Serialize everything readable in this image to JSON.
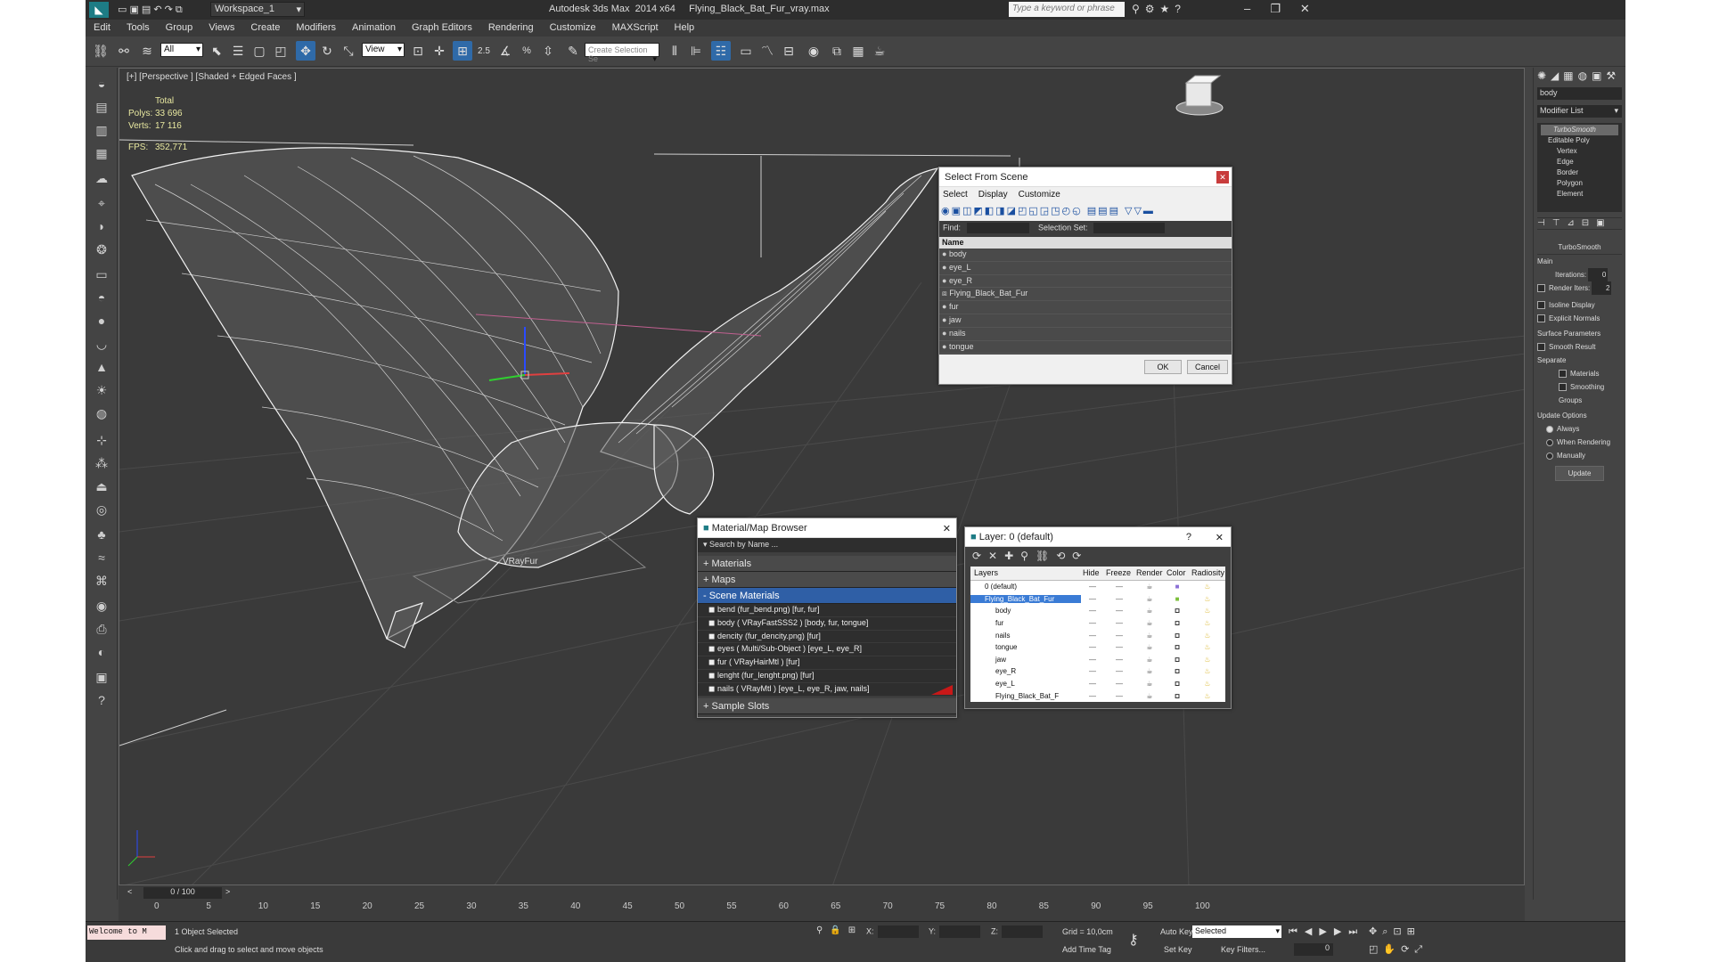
{
  "titlebar": {
    "workspace": "Workspace_1",
    "title": "Autodesk 3ds Max  2014 x64     Flying_Black_Bat_Fur_vray.max",
    "search_placeholder": "Type a keyword or phrase"
  },
  "menu": [
    "Edit",
    "Tools",
    "Group",
    "Views",
    "Create",
    "Modifiers",
    "Animation",
    "Graph Editors",
    "Rendering",
    "Customize",
    "MAXScript",
    "Help"
  ],
  "toolbar": {
    "filter": "All",
    "view": "View",
    "selection_set": "Create Selection Se",
    "angle": "2.5"
  },
  "viewport": {
    "label": "[+] [Perspective ] [Shaded + Edged Faces ]",
    "stats_total": "Total",
    "polys_label": "Polys:",
    "polys": "33 696",
    "verts_label": "Verts:",
    "verts": "17 116",
    "fps_label": "FPS:",
    "fps": "352,771",
    "vrayfur_label": "VRayFur"
  },
  "right_panel": {
    "object_name": "body",
    "modifier_list": "Modifier List",
    "stack": [
      "TurboSmooth",
      "Editable Poly",
      "Vertex",
      "Edge",
      "Border",
      "Polygon",
      "Element"
    ],
    "rollout": "TurboSmooth",
    "main": "Main",
    "iterations_label": "Iterations:",
    "iterations": "0",
    "render_iters_label": "Render Iters:",
    "render_iters": "2",
    "isoline": "Isoline Display",
    "explicit": "Explicit Normals",
    "surface_params": "Surface Parameters",
    "smooth_result": "Smooth Result",
    "separate": "Separate",
    "materials": "Materials",
    "smoothing_groups": "Smoothing Groups",
    "update_options": "Update Options",
    "always": "Always",
    "when_rendering": "When Rendering",
    "manually": "Manually",
    "update_btn": "Update"
  },
  "select_dialog": {
    "title": "Select From Scene",
    "menu": [
      "Select",
      "Display",
      "Customize"
    ],
    "find_label": "Find:",
    "selection_set_label": "Selection Set:",
    "col_name": "Name",
    "items": [
      "body",
      "eye_L",
      "eye_R",
      "Flying_Black_Bat_Fur",
      "fur",
      "jaw",
      "nails",
      "tongue"
    ],
    "ok": "OK",
    "cancel": "Cancel"
  },
  "material_browser": {
    "title": "Material/Map Browser",
    "search": "Search by Name ...",
    "materials": "+ Materials",
    "maps": "+ Maps",
    "scene_materials": "- Scene Materials",
    "items": [
      "bend (fur_bend.png)  [fur, fur]",
      "body  ( VRayFastSSS2 )  [body, fur, tongue]",
      "dencity (fur_dencity.png)  [fur]",
      "eyes  ( Multi/Sub-Object )  [eye_L, eye_R]",
      "fur  ( VRayHairMtl )  [fur]",
      "lenght (fur_lenght.png)  [fur]",
      "nails  ( VRayMtl )  [eye_L, eye_R, jaw, nails]"
    ],
    "sample_slots": "+ Sample Slots"
  },
  "layer_dialog": {
    "title": "Layer: 0 (default)",
    "help": "?",
    "cols": [
      "Layers",
      "Hide",
      "Freeze",
      "Render",
      "Color",
      "Radiosity"
    ],
    "rows": [
      "0 (default)",
      "Flying_Black_Bat_Fur",
      "body",
      "fur",
      "nails",
      "tongue",
      "jaw",
      "eye_R",
      "eye_L",
      "Flying_Black_Bat_F"
    ]
  },
  "timeline": {
    "frame": "0 / 100",
    "ticks": [
      "0",
      "5",
      "10",
      "15",
      "20",
      "25",
      "30",
      "35",
      "40",
      "45",
      "50",
      "55",
      "60",
      "65",
      "70",
      "75",
      "80",
      "85",
      "90",
      "95",
      "100"
    ]
  },
  "status": {
    "welcome": "Welcome to M",
    "selected": "1 Object Selected",
    "hint": "Click and drag to select and move objects",
    "x_label": "X:",
    "y_label": "Y:",
    "z_label": "Z:",
    "grid": "Grid = 10,0cm",
    "add_time_tag": "Add Time Tag",
    "auto_key": "Auto Key",
    "set_key": "Set Key",
    "selected_dd": "Selected",
    "key_filters": "Key Filters...",
    "frame_field": "0"
  }
}
